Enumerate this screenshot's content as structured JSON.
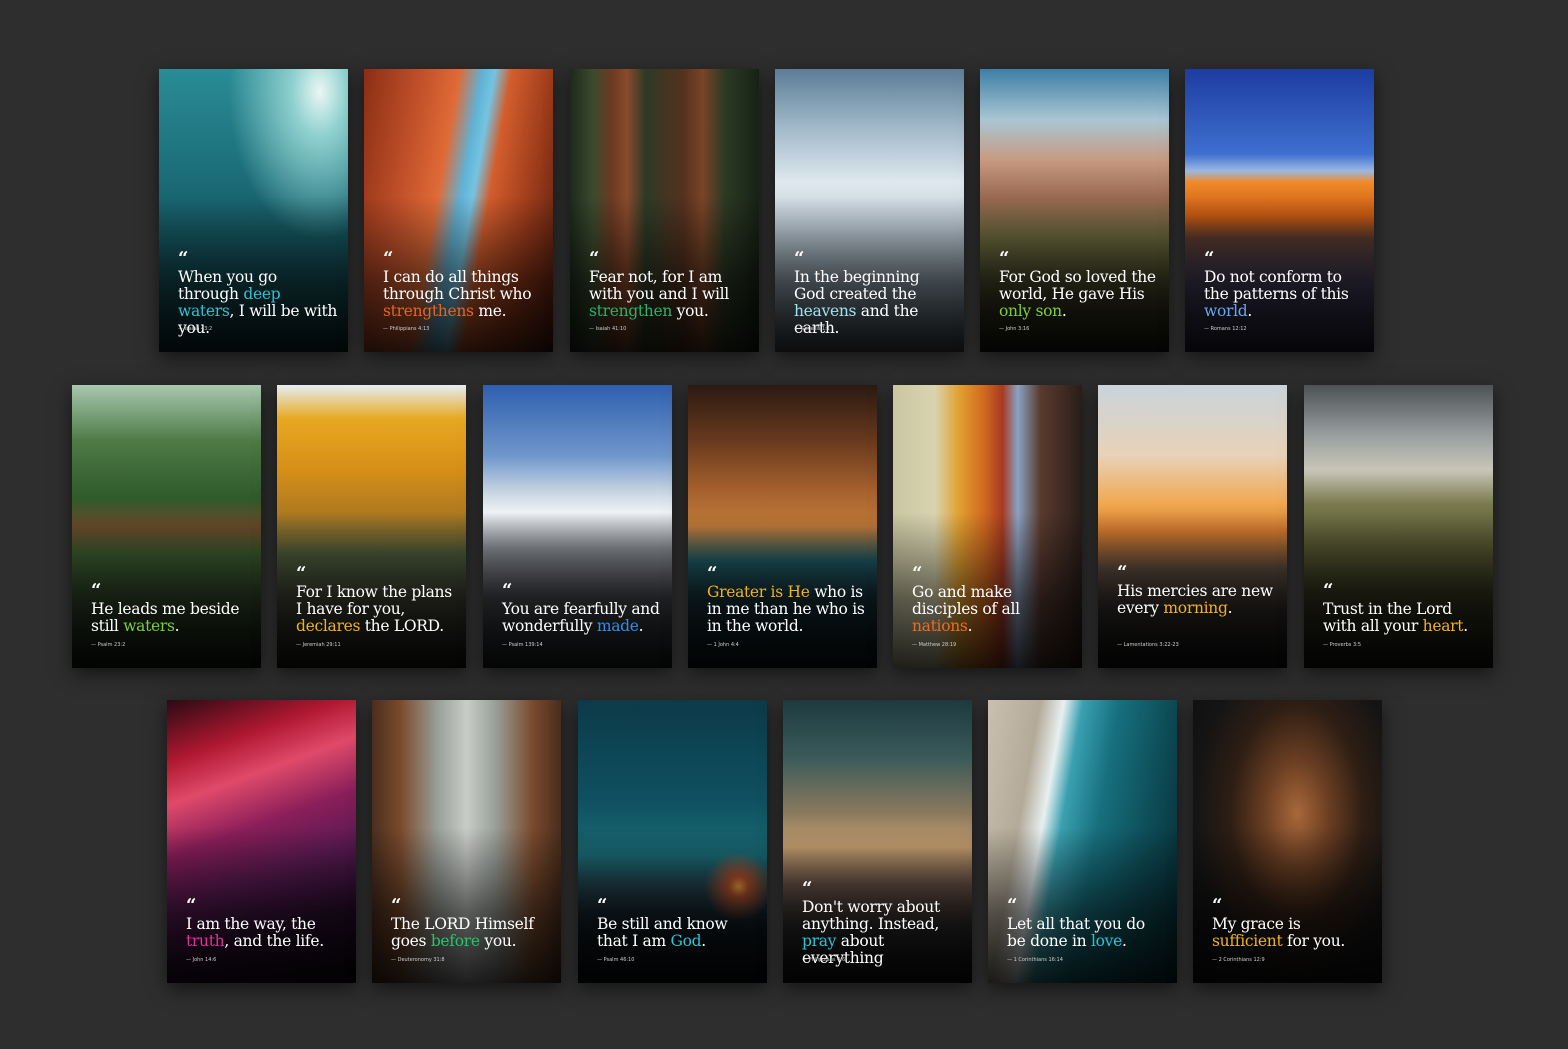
{
  "cards": [
    {
      "pre": "When you go through ",
      "hl": "deep waters",
      "post": ", I will be with you.",
      "ref": "—  Isaiah 43:2",
      "hl_color": "#2ec4d6"
    },
    {
      "pre": "I can do all things through Christ who ",
      "hl": "strengthens",
      "post": " me.",
      "ref": "—  Philippians 4:13",
      "hl_color": "#e8641c"
    },
    {
      "pre": "Fear not, for I am with you and I will ",
      "hl": "strengthen",
      "post": " you.",
      "ref": "—  Isaiah 41:10",
      "hl_color": "#28b36a"
    },
    {
      "pre": "In the beginning God created the ",
      "hl": "heavens",
      "post": " and the earth.",
      "ref": "—  Genesis 1:1",
      "hl_color": "#9fe3f2"
    },
    {
      "pre": "For God so loved the world, He gave His ",
      "hl": "only son",
      "post": ".",
      "ref": "—  John 3:16",
      "hl_color": "#7ccf3a"
    },
    {
      "pre": "Do not conform to the patterns of this ",
      "hl": "world",
      "post": ".",
      "ref": "—  Romans 12:12",
      "hl_color": "#6aa6f0"
    },
    {
      "pre": "He leads me beside still ",
      "hl": "waters",
      "post": ".",
      "ref": "—  Psalm 23:2",
      "hl_color": "#7ccf3a"
    },
    {
      "pre": "For I know the plans I have for you, ",
      "hl": "declares",
      "post": " the LORD.",
      "ref": "—  Jeremiah 29:11",
      "hl_color": "#f2b21b"
    },
    {
      "pre": "You are fearfully and wonderfully ",
      "hl": "made",
      "post": ".",
      "ref": "—  Psalm 139:14",
      "hl_color": "#2f8cf0"
    },
    {
      "pre": "",
      "hl": "Greater is He",
      "post": " who is in me than he who is in the world.",
      "ref": "—  1 John 4:4",
      "hl_color": "#f2b21b"
    },
    {
      "pre": "Go and make disciples of all ",
      "hl": "nations",
      "post": ".",
      "ref": "—  Matthew 28:19",
      "hl_color": "#f06a1c"
    },
    {
      "pre": "His mercies are new every ",
      "hl": "morning",
      "post": ".",
      "ref": "—  Lamentations 3:22-23",
      "hl_color": "#f2b21b"
    },
    {
      "pre": "Trust in the Lord with all your ",
      "hl": "heart",
      "post": ".",
      "ref": "—  Proverbs 3:5",
      "hl_color": "#f2b21b"
    },
    {
      "pre": "I am the way, the ",
      "hl": "truth",
      "post": ", and the life.",
      "ref": "—  John 14:6",
      "hl_color": "#e0329a"
    },
    {
      "pre": "The LORD Himself goes ",
      "hl": "before",
      "post": " you.",
      "ref": "—  Deuteronomy 31:8",
      "hl_color": "#28c46a"
    },
    {
      "pre": "Be still and know that I am ",
      "hl": "God",
      "post": ".",
      "ref": "—  Psalm 46:10",
      "hl_color": "#22c7d8"
    },
    {
      "pre": "Don't worry about anything. Instead, ",
      "hl": "pray",
      "post": " about everything",
      "ref": "—  Philippians 4:6",
      "hl_color": "#22c7d8"
    },
    {
      "pre": "Let all that you do be done in ",
      "hl": "love",
      "post": ".",
      "ref": "—  1 Corinthians 16:14",
      "hl_color": "#22c7d8"
    },
    {
      "pre": "My grace is ",
      "hl": "sufficient",
      "post": " for you.",
      "ref": "—  2 Corinthians 12:9",
      "hl_color": "#f2b21b"
    }
  ]
}
